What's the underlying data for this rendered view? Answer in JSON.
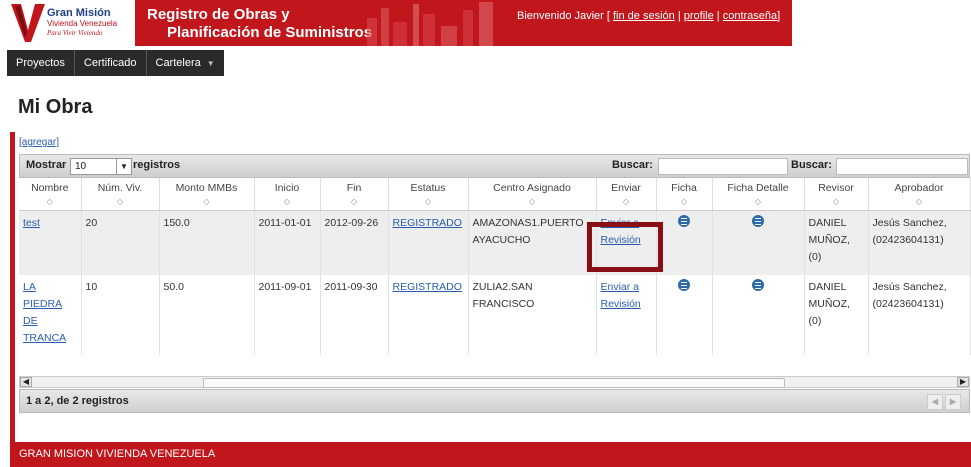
{
  "logo": {
    "line1": "Gran Misión",
    "line2": "Vivienda Venezuela",
    "line3": "Para Vivir Viviendo"
  },
  "banner": {
    "title_line1": "Registro de Obras y",
    "title_line2": "Planificación de Suministros"
  },
  "header": {
    "welcome_prefix": "Bienvenido Javier [ ",
    "logout": "fin de sesión",
    "sep1": " | ",
    "profile": "profile",
    "sep2": " | ",
    "password": "contraseña",
    "suffix": "]"
  },
  "nav": {
    "items": [
      "Proyectos",
      "Certificado",
      "Cartelera"
    ]
  },
  "page": {
    "title": "Mi Obra",
    "add_link": "[agregar]"
  },
  "table_toolbar": {
    "show_label": "Mostrar",
    "show_value": "10",
    "records_label": "registros",
    "search_label_1": "Buscar:",
    "search_label_2": "Buscar:"
  },
  "table": {
    "columns": [
      "Nombre",
      "Núm. Viv.",
      "Monto MMBs",
      "Inicio",
      "Fin",
      "Estatus",
      "Centro Asignado",
      "Enviar",
      "Ficha",
      "Ficha Detalle",
      "Revisor",
      "Aprobador"
    ],
    "rows": [
      {
        "nombre": "test",
        "num_viv": "20",
        "monto": "150.0",
        "inicio": "2011-01-01",
        "fin": "2012-09-26",
        "estatus": "REGISTRADO",
        "centro": "AMAZONAS1.PUERTO AYACUCHO",
        "enviar": "Enviar a Revisión",
        "revisor": "DANIEL MUÑOZ, (0)",
        "aprobador": "Jesús Sanchez, (02423604131)"
      },
      {
        "nombre": "LA PIEDRA DE TRANCA",
        "num_viv": "10",
        "monto": "50.0",
        "inicio": "2011-09-01",
        "fin": "2011-09-30",
        "estatus": "REGISTRADO",
        "centro": "ZULIA2.SAN FRANCISCO",
        "enviar": "Enviar a Revisión",
        "revisor": "DANIEL MUÑOZ, (0)",
        "aprobador": "Jesús Sanchez, (02423604131)"
      }
    ]
  },
  "table_footer": {
    "info": "1 a 2, de 2 registros"
  },
  "site_footer": {
    "text": "GRAN MISION VIVIENDA VENEZUELA"
  },
  "colors": {
    "brand_red": "#c1161c",
    "nav_dark": "#2a2a2a",
    "link_blue": "#2a5db0",
    "highlight": "#8a0f14"
  },
  "icons": {
    "ficha": "list-icon",
    "sort": "sort-icon"
  }
}
